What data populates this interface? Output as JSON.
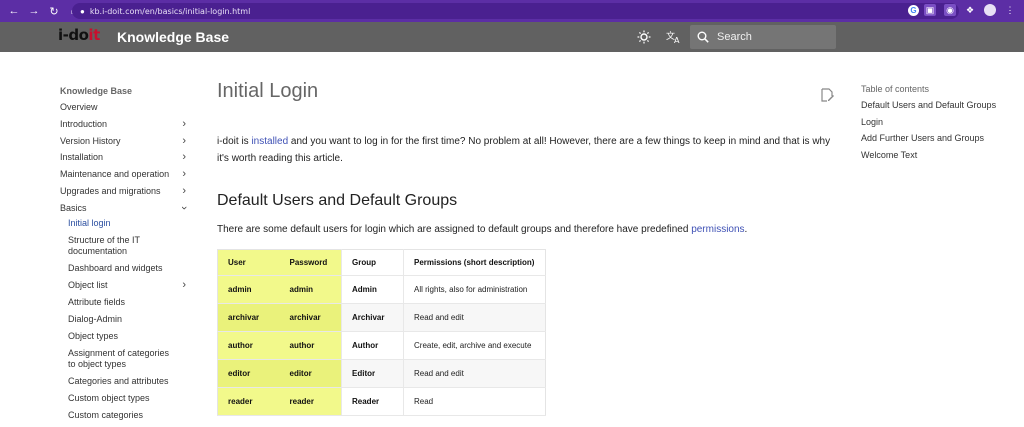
{
  "browser": {
    "url": "kb.i-doit.com/en/basics/initial-login.html",
    "back_icon": "back-arrow-icon",
    "forward_icon": "forward-arrow-icon",
    "reload_icon": "reload-icon",
    "home_icon": "home-icon"
  },
  "header": {
    "logo_main": "i-do",
    "logo_accent": "it",
    "site_title": "Knowledge Base",
    "search_placeholder": "Search"
  },
  "sidebar": {
    "title": "Knowledge Base",
    "items": [
      {
        "label": "Overview",
        "has_children": false
      },
      {
        "label": "Introduction",
        "has_children": true
      },
      {
        "label": "Version History",
        "has_children": true
      },
      {
        "label": "Installation",
        "has_children": true
      },
      {
        "label": "Maintenance and operation",
        "has_children": true
      },
      {
        "label": "Upgrades and migrations",
        "has_children": true
      },
      {
        "label": "Basics",
        "has_children": true,
        "expanded": true
      }
    ],
    "sub_items": [
      {
        "label": "Initial login",
        "active": true
      },
      {
        "label": "Structure of the IT documentation"
      },
      {
        "label": "Dashboard and widgets"
      },
      {
        "label": "Object list",
        "has_children": true
      },
      {
        "label": "Attribute fields"
      },
      {
        "label": "Dialog-Admin"
      },
      {
        "label": "Object types"
      },
      {
        "label": "Assignment of categories to object types"
      },
      {
        "label": "Categories and attributes"
      },
      {
        "label": "Custom object types"
      },
      {
        "label": "Custom categories"
      }
    ]
  },
  "main": {
    "title": "Initial Login",
    "intro_pre": "i-doit is ",
    "intro_link": "installed",
    "intro_post": " and you want to log in for the first time? No problem at all! However, there are a few things to keep in mind and that is why it's worth reading this article.",
    "section_title": "Default Users and Default Groups",
    "lead_pre": "There are some default users for login which are assigned to default groups and therefore have predefined ",
    "lead_link": "permissions",
    "lead_post": ".",
    "table": {
      "headers": [
        "User",
        "Password",
        "Group",
        "Permissions (short description)"
      ],
      "rows": [
        [
          "admin",
          "admin",
          "Admin",
          "All rights, also for administration"
        ],
        [
          "archivar",
          "archivar",
          "Archivar",
          "Read and edit"
        ],
        [
          "author",
          "author",
          "Author",
          "Create, edit, archive and execute"
        ],
        [
          "editor",
          "editor",
          "Editor",
          "Read and edit"
        ],
        [
          "reader",
          "reader",
          "Reader",
          "Read"
        ]
      ]
    }
  },
  "toc": {
    "title": "Table of contents",
    "items": [
      "Default Users and Default Groups",
      "Login",
      "Add Further Users and Groups",
      "Welcome Text"
    ]
  },
  "colors": {
    "browser_bar": "#5c2ea5",
    "site_header": "#616161",
    "link": "#3f51b5",
    "highlight": "#f2f98b"
  }
}
